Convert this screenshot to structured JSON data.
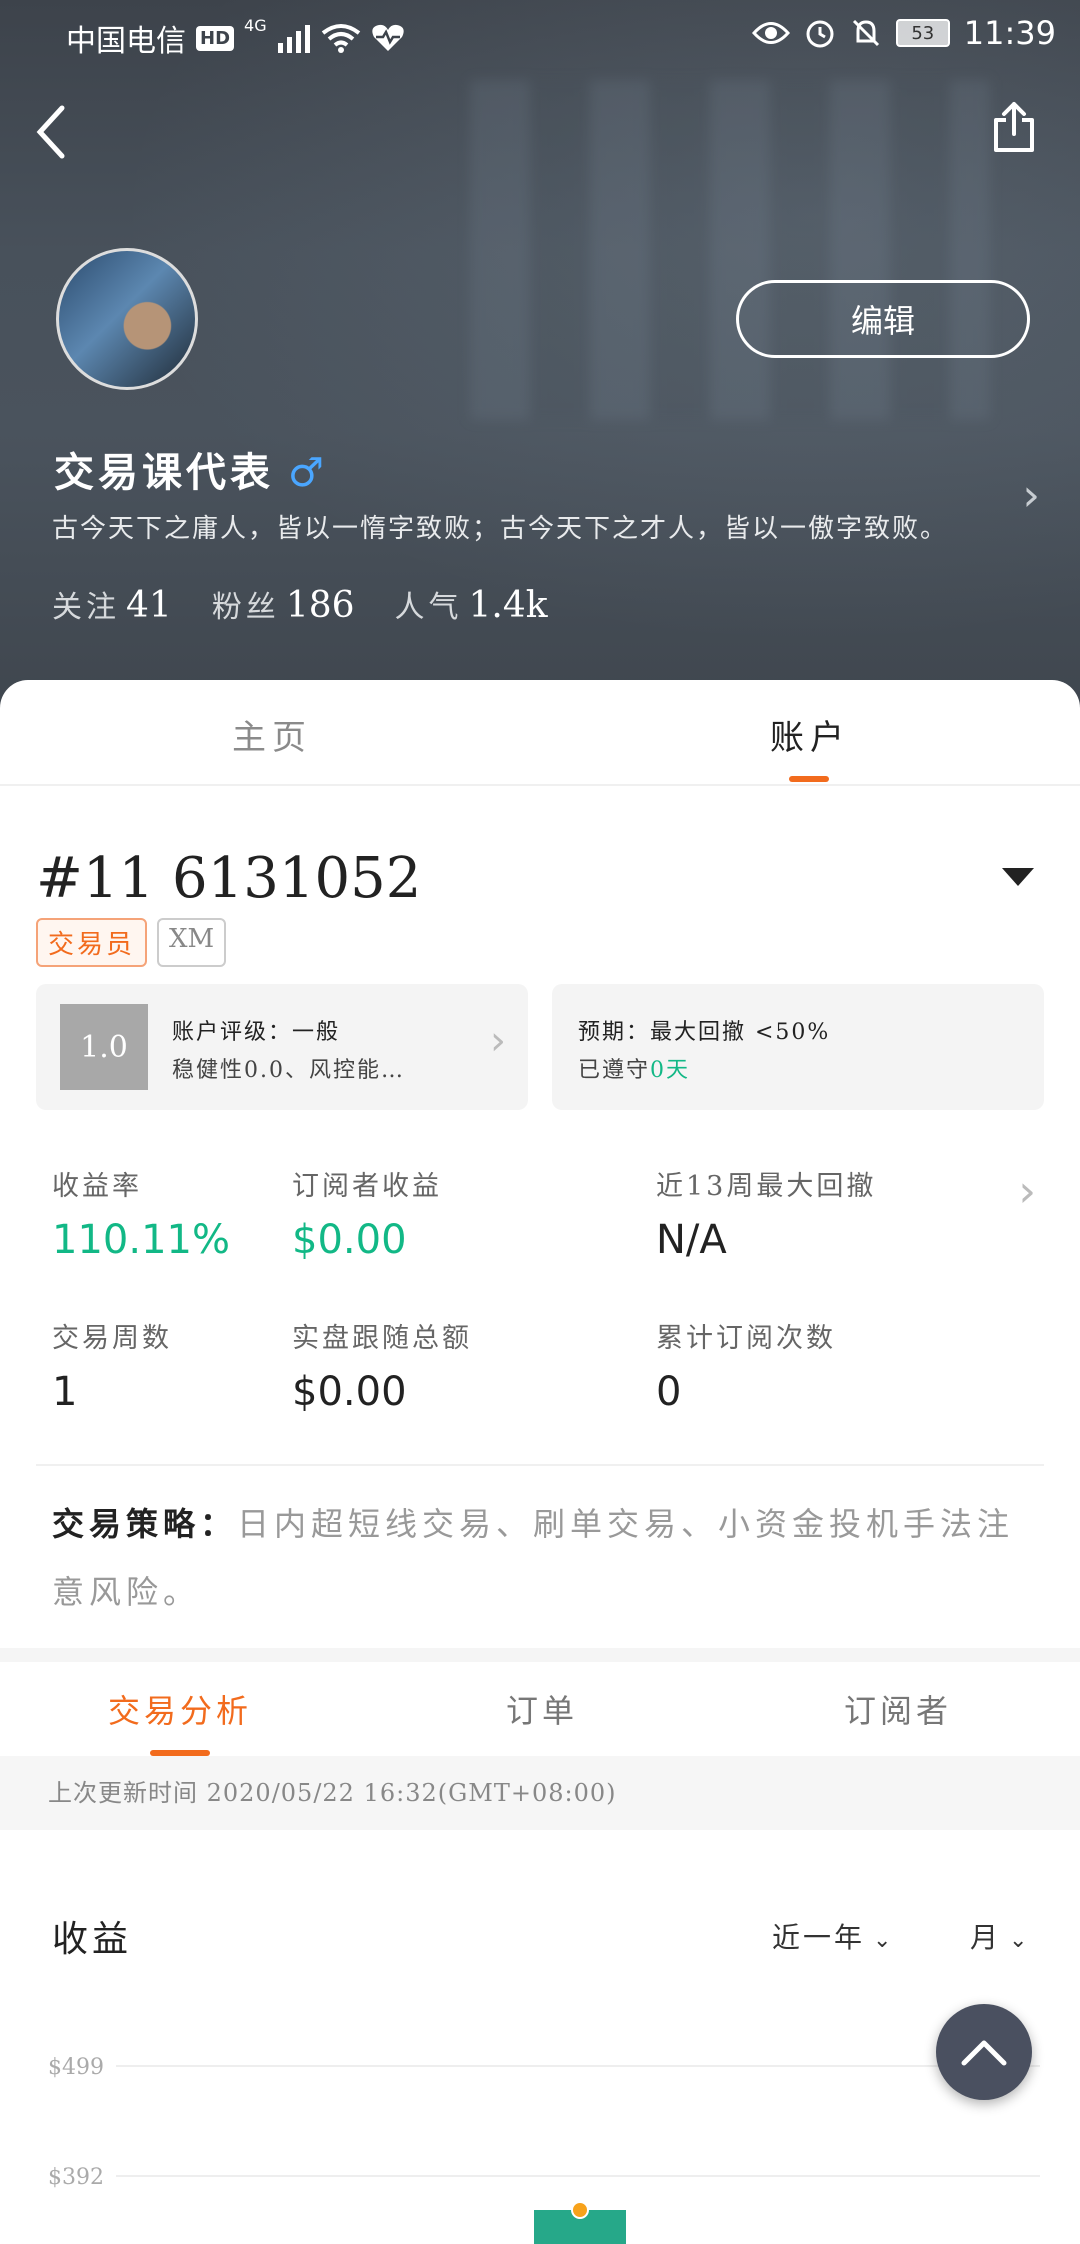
{
  "status_bar": {
    "carrier": "中国电信",
    "hd": "HD",
    "network": "4G",
    "battery": "53",
    "time": "11:39"
  },
  "profile": {
    "edit_label": "编辑",
    "username": "交易课代表",
    "gender_symbol": "♂",
    "bio": "古今天下之庸人，皆以一惰字致败；古今天下之才人，皆以一傲字致败。",
    "stats": [
      {
        "label": "关注",
        "value": "41"
      },
      {
        "label": "粉丝",
        "value": "186"
      },
      {
        "label": "人气",
        "value": "1.4k"
      }
    ]
  },
  "main_tabs": [
    "主页",
    "账户"
  ],
  "account": {
    "number": "#11 6131052",
    "tags": [
      "交易员",
      "XM"
    ],
    "rating_score": "1.0",
    "rating_line1": "账户评级：一般",
    "rating_line2": "稳健性0.0、风控能…",
    "expect_line1": "预期：最大回撤 <50%",
    "expect_prefix": "已遵守",
    "expect_days": "0天"
  },
  "metrics": [
    {
      "label": "收益率",
      "value": "110.11%"
    },
    {
      "label": "订阅者收益",
      "value": "$0.00"
    },
    {
      "label": "近13周最大回撤",
      "value": "N/A"
    },
    {
      "label": "交易周数",
      "value": "1"
    },
    {
      "label": "实盘跟随总额",
      "value": "$0.00"
    },
    {
      "label": "累计订阅次数",
      "value": "0"
    }
  ],
  "strategy": {
    "label": "交易策略：",
    "text": "日内超短线交易、刷单交易、小资金投机手法注意风险。"
  },
  "sub_tabs": [
    "交易分析",
    "订单",
    "订阅者"
  ],
  "update_text": "上次更新时间 2020/05/22 16:32(GMT+08:00)",
  "chart_section": {
    "title": "收益",
    "range_select": "近一年",
    "period_select": "月"
  },
  "chart_data": {
    "type": "bar",
    "title": "",
    "y_ticks": [
      "$499",
      "$392"
    ],
    "colors": {
      "bar": "#26a889",
      "point": "#f7a21b",
      "grid": "#eeeeee"
    }
  },
  "colors": {
    "accent": "#f26b1d",
    "positive": "#12b886"
  }
}
